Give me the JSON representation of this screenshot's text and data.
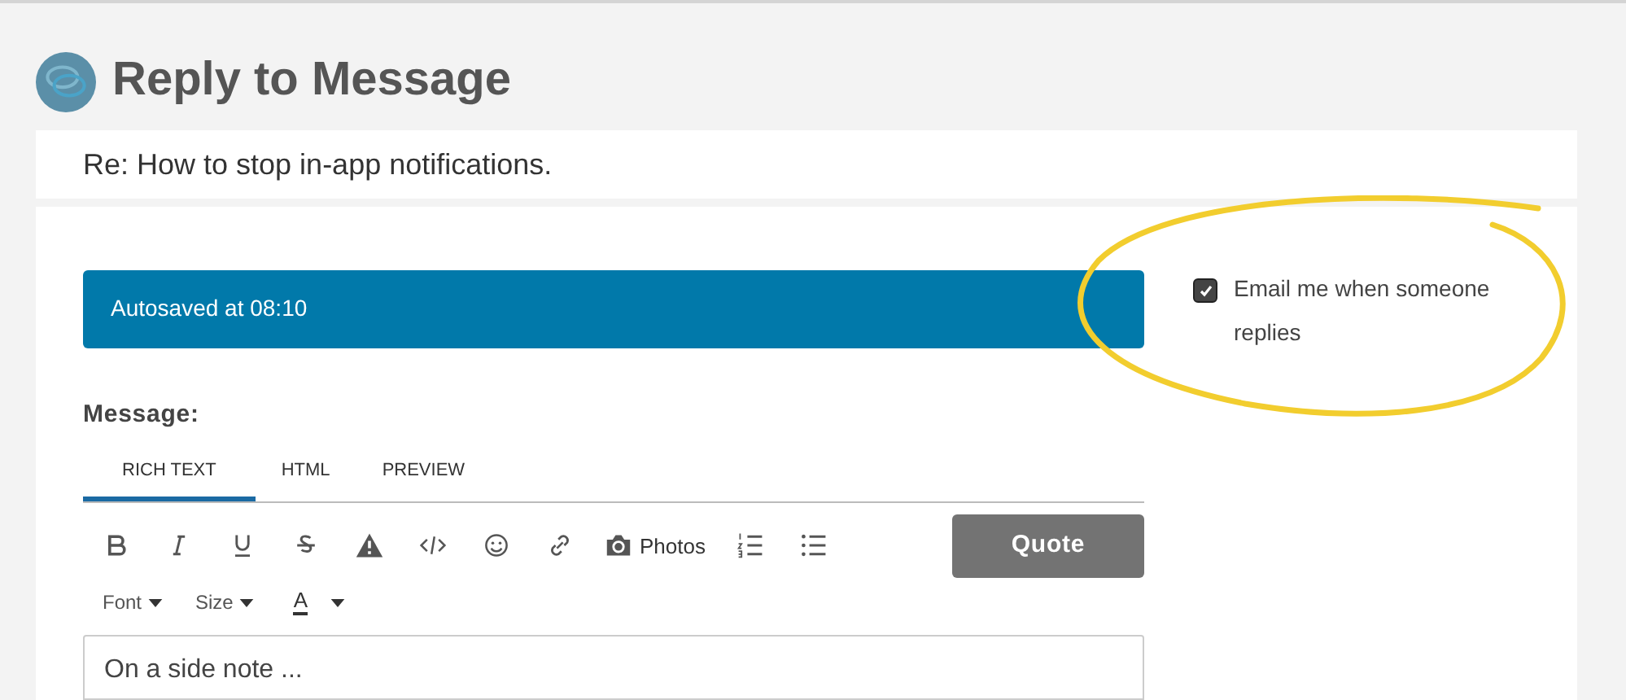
{
  "page_title": "Reply to Message",
  "subject": "Re: How to stop in-app notifications.",
  "autosave": "Autosaved at 08:10",
  "email_option": {
    "label": "Email me when someone replies",
    "checked": true
  },
  "message_label": "Message:",
  "tabs": [
    {
      "label": "RICH TEXT",
      "selected": true
    },
    {
      "label": "HTML",
      "selected": false
    },
    {
      "label": "PREVIEW",
      "selected": false
    }
  ],
  "toolbar": {
    "photos_label": "Photos",
    "quote_button": "Quote",
    "dropdowns": [
      "Font",
      "Size"
    ],
    "color_button": "A"
  },
  "editor": {
    "value": "On a side note ..."
  }
}
